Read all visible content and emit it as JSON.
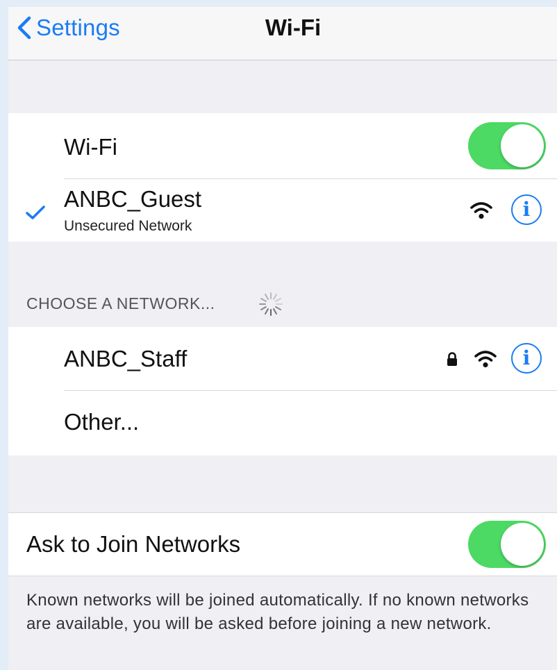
{
  "navbar": {
    "back_label": "Settings",
    "title": "Wi-Fi"
  },
  "wifi_group": {
    "wifi_label": "Wi-Fi",
    "wifi_enabled": true,
    "connected": {
      "name": "ANBC_Guest",
      "subtitle": "Unsecured Network",
      "secured": false
    }
  },
  "choose_section": {
    "header": "CHOOSE A NETWORK...",
    "networks": [
      {
        "name": "ANBC_Staff",
        "secured": true
      },
      {
        "name": "Other..."
      }
    ]
  },
  "ask_group": {
    "label": "Ask to Join Networks",
    "enabled": true,
    "footer": "Known networks will be joined automatically. If no known networks are available, you will be asked before joining a new network."
  },
  "colors": {
    "accent": "#1a7cf2",
    "toggle_on": "#4cd964",
    "background": "#efeff4"
  }
}
